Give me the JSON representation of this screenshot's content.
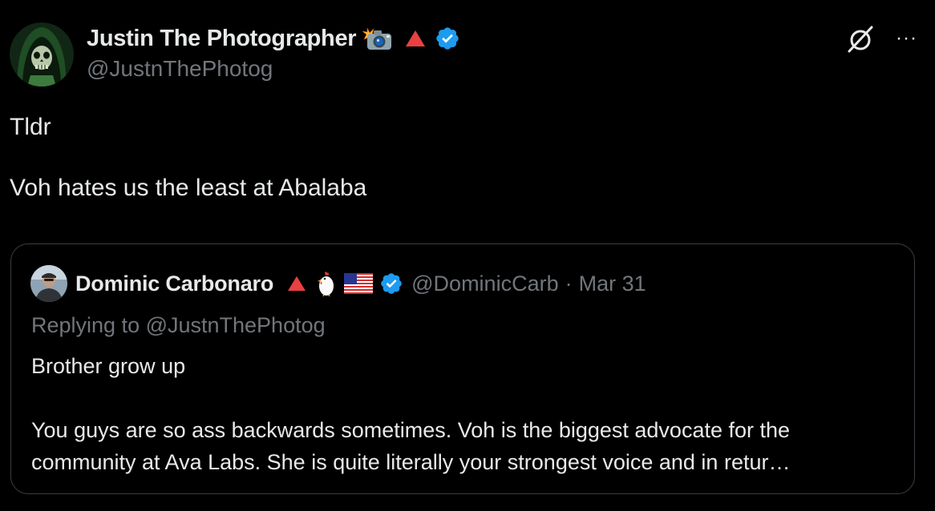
{
  "tweet": {
    "author": {
      "display_name": "Justin The Photographer",
      "handle": "@JustnThePhotog",
      "badges": [
        "camera-flash-emoji",
        "red-triangle-icon",
        "verified-icon"
      ]
    },
    "body": "Tldr\n\nVoh hates us the least at Abalaba",
    "actions": {
      "grok_icon": "grok-icon",
      "more_label": "···"
    }
  },
  "quoted_tweet": {
    "author": {
      "display_name": "Dominic Carbonaro",
      "handle": "@DominicCarb",
      "badges": [
        "red-triangle-icon",
        "chicken-emoji",
        "us-flag-emoji",
        "verified-icon"
      ]
    },
    "separator": "·",
    "date": "Mar 31",
    "replying_to": "Replying to @JustnThePhotog",
    "body": "Brother grow up\n\nYou guys are so ass backwards sometimes. Voh is the biggest advocate for the community at Ava Labs. She is quite literally your strongest voice and in retur…"
  },
  "colors": {
    "background": "#000000",
    "primary_text": "#e7e9ea",
    "secondary_text": "#71767b",
    "border": "#3a3e43",
    "verified_blue": "#1d9bf0",
    "avax_red": "#e84142"
  }
}
